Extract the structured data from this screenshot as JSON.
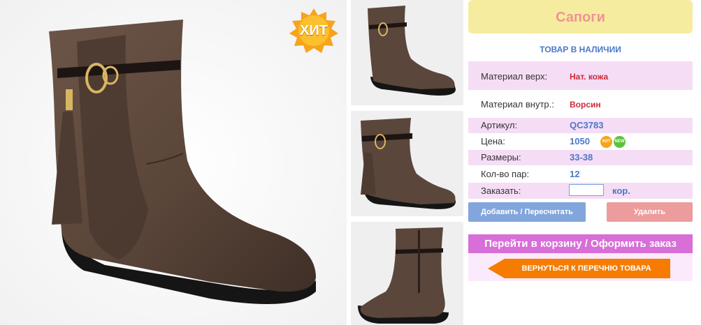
{
  "product": {
    "title": "Сапоги",
    "stock_status": "ТОВАР В НАЛИЧИИ",
    "hit_badge": "ХИТ"
  },
  "details": [
    {
      "label": "Материал верх:",
      "value": "Нат. кожа"
    },
    {
      "label": "Материал внутр.:",
      "value": "Ворсин"
    },
    {
      "label": "Артикул:",
      "value": "QC3783"
    },
    {
      "label": "Цена:",
      "value": "1050"
    },
    {
      "label": "Размеры:",
      "value": "33-38"
    },
    {
      "label": "Кол-во пар:",
      "value": "12"
    }
  ],
  "price_badges": {
    "hit": "ХИТ",
    "new": "NEW"
  },
  "order": {
    "label": "Заказать:",
    "quantity_value": "",
    "unit": "кор."
  },
  "buttons": {
    "add": "Добавить / Пересчитать",
    "remove": "Удалить",
    "cart": "Перейти в корзину / Оформить заказ",
    "back": "ВЕРНУТЬСЯ К ПЕРЕЧНЮ ТОВАРА"
  },
  "icons": {
    "main_image": "suede-boot-photo",
    "thumbnails": [
      "boot-thumbnail-1",
      "boot-thumbnail-2",
      "boot-thumbnail-3"
    ]
  },
  "colors": {
    "title_bg": "#f6ec9f",
    "title_text": "#ee9494",
    "row_pink": "#f5ddf5",
    "accent_blue": "#4a78c8",
    "accent_red": "#cc2b3b",
    "add_button": "#82a6dc",
    "remove_button": "#ec9c9c",
    "cart_bar": "#d86ed8",
    "back_button": "#f57c00"
  }
}
